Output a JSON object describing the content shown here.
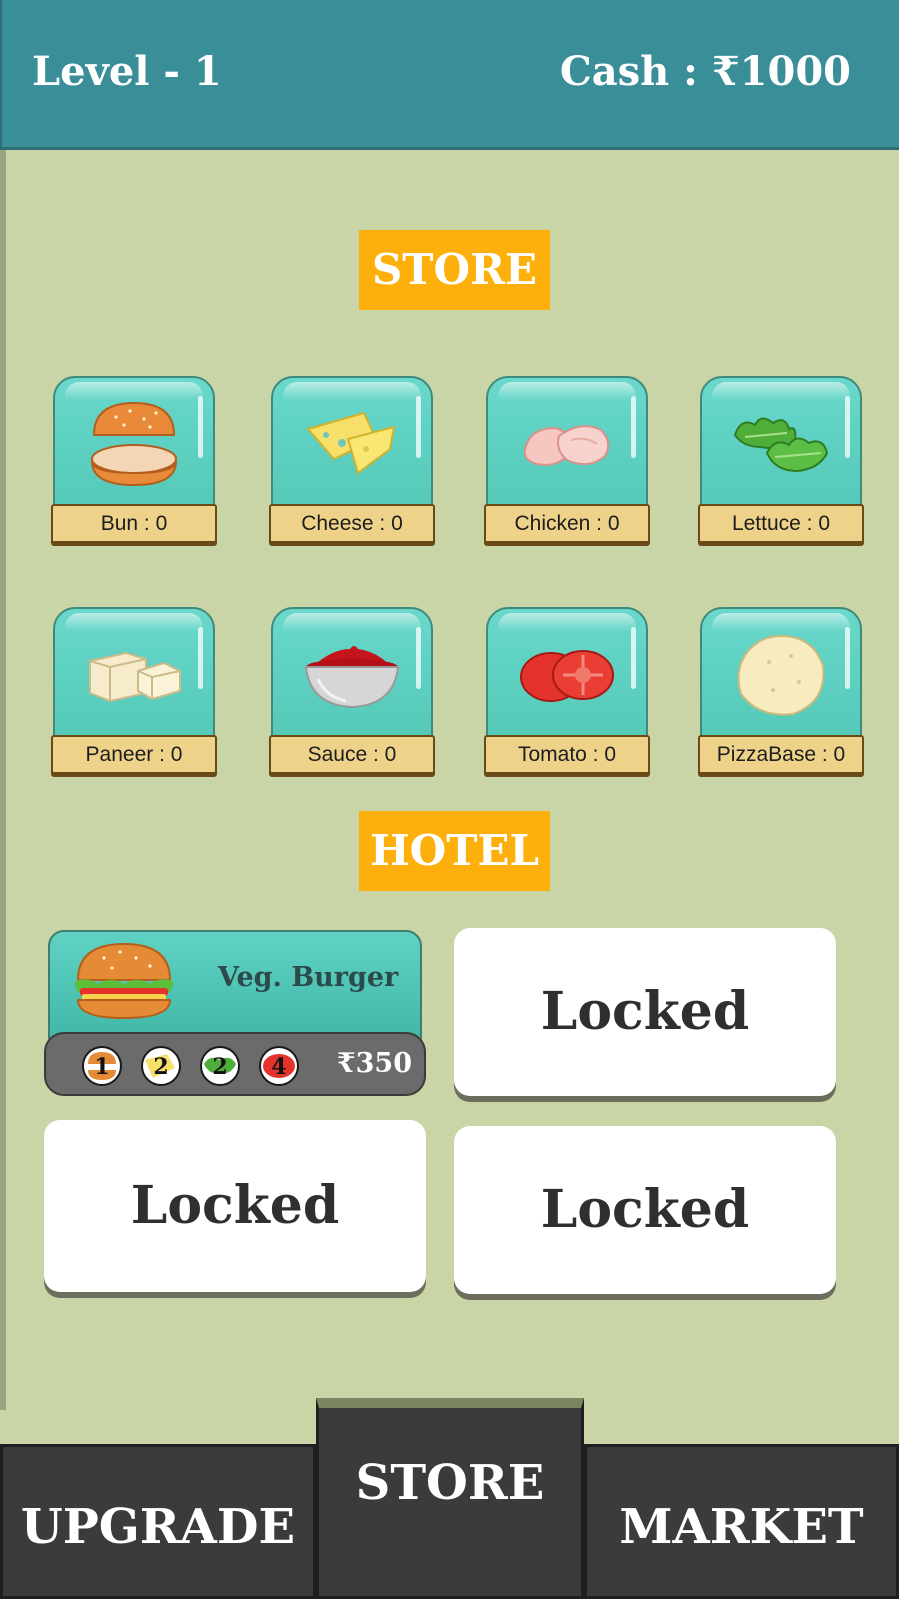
{
  "header": {
    "level_text": "Level - 1",
    "cash_text": "Cash : ₹1000"
  },
  "sections": {
    "store_label": "STORE",
    "hotel_label": "HOTEL"
  },
  "store_items": [
    {
      "label": "Bun : 0",
      "icon": "bun-icon"
    },
    {
      "label": "Cheese : 0",
      "icon": "cheese-icon"
    },
    {
      "label": "Chicken : 0",
      "icon": "chicken-icon"
    },
    {
      "label": "Lettuce : 0",
      "icon": "lettuce-icon"
    },
    {
      "label": "Paneer : 0",
      "icon": "paneer-icon"
    },
    {
      "label": "Sauce : 0",
      "icon": "sauce-icon"
    },
    {
      "label": "Tomato : 0",
      "icon": "tomato-icon"
    },
    {
      "label": "PizzaBase : 0",
      "icon": "pizza-base-icon"
    }
  ],
  "hotel": {
    "dish": {
      "name": "Veg. Burger",
      "icon": "burger-icon",
      "ingredients": [
        {
          "qty": "1",
          "icon": "bun-icon"
        },
        {
          "qty": "2",
          "icon": "cheese-icon"
        },
        {
          "qty": "2",
          "icon": "lettuce-icon"
        },
        {
          "qty": "4",
          "icon": "tomato-icon"
        }
      ],
      "price": "₹350"
    },
    "locked_label": "Locked"
  },
  "nav": {
    "upgrade": "UPGRADE",
    "store": "STORE",
    "market": "MARKET"
  },
  "colors": {
    "header_bg": "#3a8e97",
    "panel_bg": "#c9d5a6",
    "section_label_bg": "#fdb00b",
    "tile_glass": "#5fd2c3",
    "tile_plate": "#eed28a",
    "nav_bg": "#3b3b3b"
  }
}
